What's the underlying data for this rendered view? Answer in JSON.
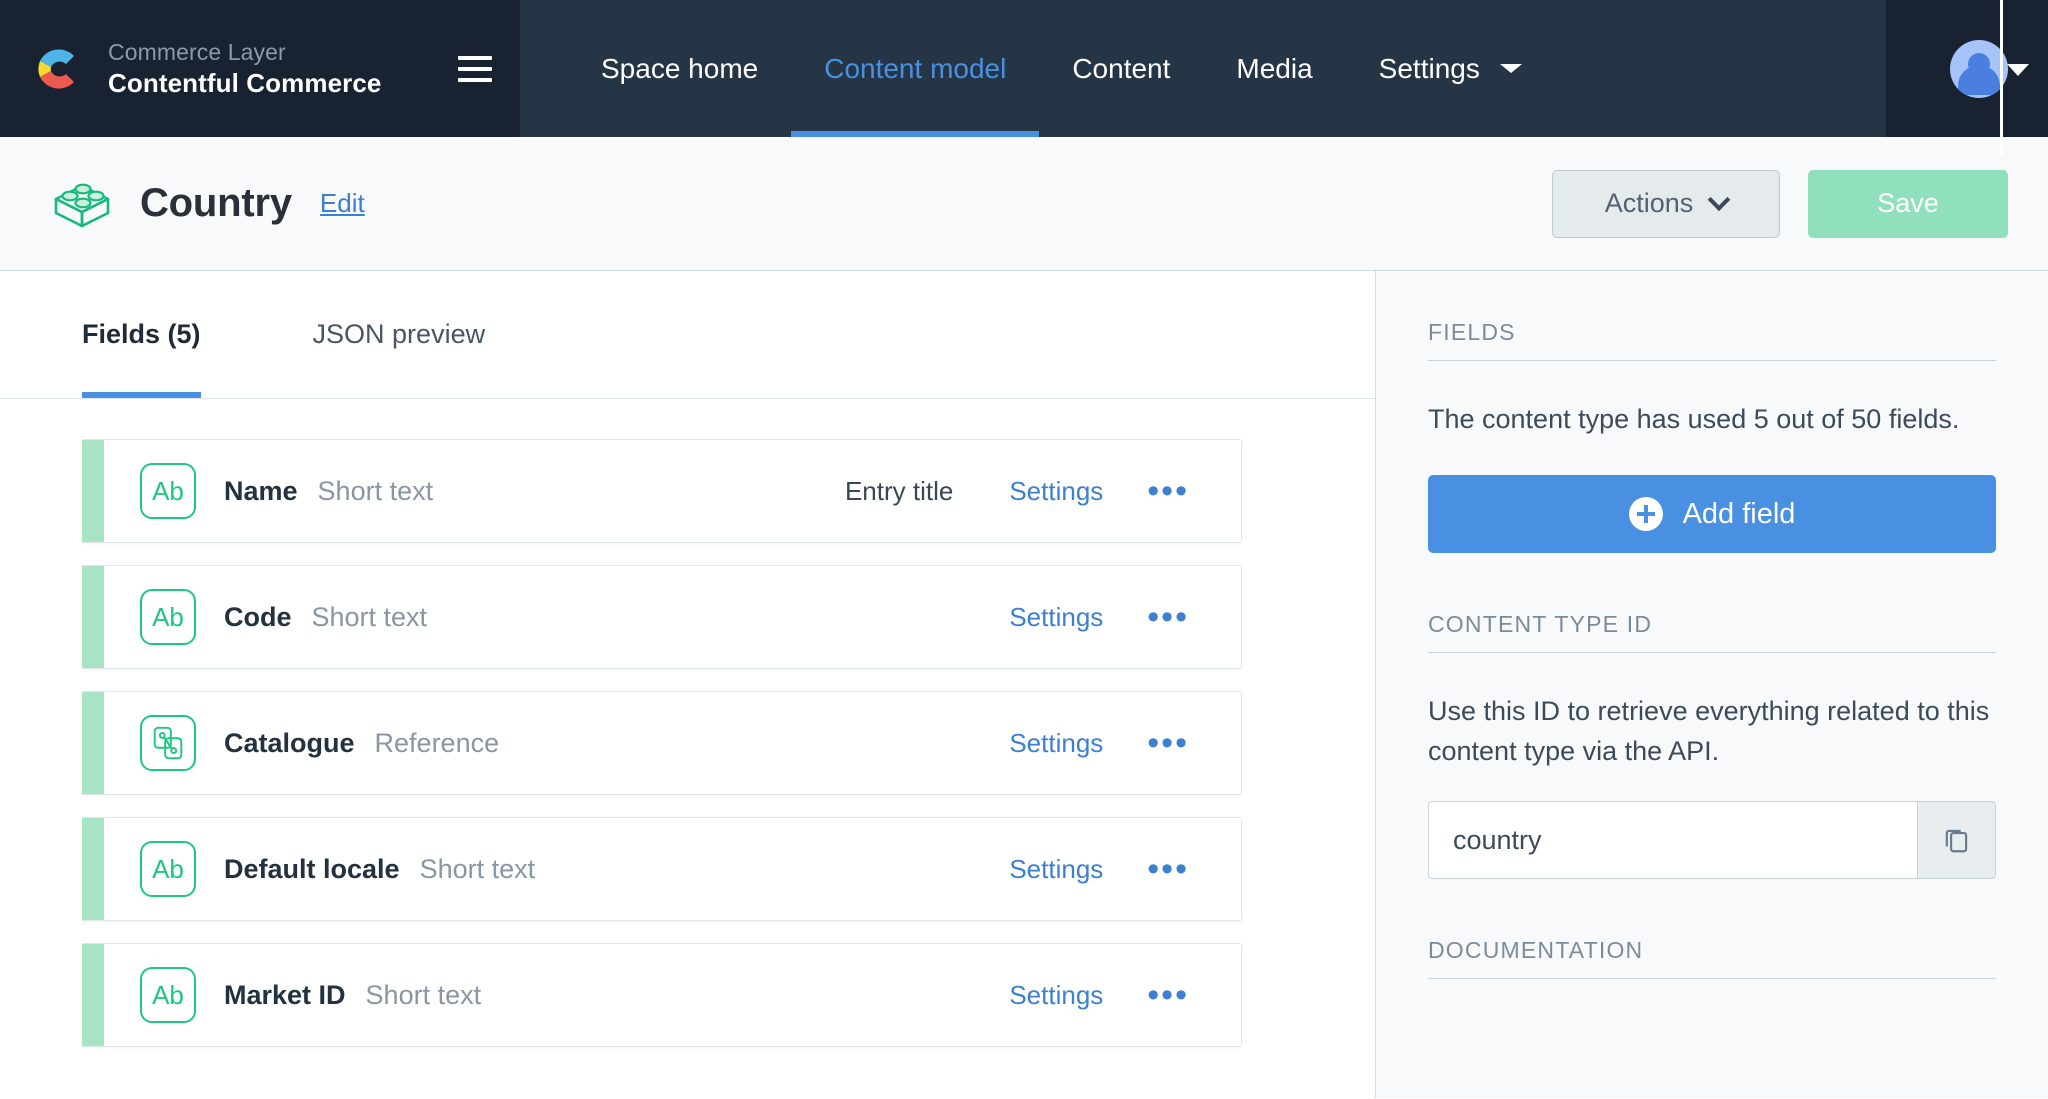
{
  "topnav": {
    "brand": {
      "org": "Commerce Layer",
      "space": "Contentful Commerce",
      "logo_icon": "commerce-layer-c-logo",
      "menu_icon": "hamburger-menu-icon"
    },
    "links": [
      {
        "label": "Space home",
        "active": false,
        "has_caret": false
      },
      {
        "label": "Content model",
        "active": true,
        "has_caret": false
      },
      {
        "label": "Content",
        "active": false,
        "has_caret": false
      },
      {
        "label": "Media",
        "active": false,
        "has_caret": false
      },
      {
        "label": "Settings",
        "active": false,
        "has_caret": true
      }
    ],
    "account": {
      "avatar_icon": "user-avatar-icon",
      "caret_icon": "chevron-down-icon"
    },
    "accent_color": "#4a90e2",
    "bar_color": "#253545",
    "brand_color": "#192231"
  },
  "pageheader": {
    "content_type_icon": "lego-brick-icon",
    "title": "Country",
    "edit_label": "Edit",
    "actions_label": "Actions",
    "actions_caret_icon": "chevron-down-icon",
    "save_label": "Save",
    "save_color": "#91e0bd"
  },
  "main": {
    "tabs": [
      {
        "label": "Fields (5)",
        "active": true
      },
      {
        "label": "JSON preview",
        "active": false
      }
    ],
    "fields": [
      {
        "name": "Name",
        "type": "Short text",
        "icon": "short-text-ab-icon",
        "icon_glyph": "Ab",
        "entry_title": "Entry title",
        "settings_label": "Settings",
        "more_label": "•••"
      },
      {
        "name": "Code",
        "type": "Short text",
        "icon": "short-text-ab-icon",
        "icon_glyph": "Ab",
        "entry_title": "",
        "settings_label": "Settings",
        "more_label": "•••"
      },
      {
        "name": "Catalogue",
        "type": "Reference",
        "icon": "reference-link-icon",
        "icon_glyph": "",
        "entry_title": "",
        "settings_label": "Settings",
        "more_label": "•••"
      },
      {
        "name": "Default locale",
        "type": "Short text",
        "icon": "short-text-ab-icon",
        "icon_glyph": "Ab",
        "entry_title": "",
        "settings_label": "Settings",
        "more_label": "•••"
      },
      {
        "name": "Market ID",
        "type": "Short text",
        "icon": "short-text-ab-icon",
        "icon_glyph": "Ab",
        "entry_title": "",
        "settings_label": "Settings",
        "more_label": "•••"
      }
    ]
  },
  "sidebar": {
    "fields_heading": "FIELDS",
    "fields_usage": "The content type has used 5 out of 50 fields.",
    "add_field_label": "Add field",
    "add_field_icon": "plus-circle-icon",
    "add_field_color": "#4a90e2",
    "id_heading": "CONTENT TYPE ID",
    "id_description": "Use this ID to retrieve everything related to this content type via the API.",
    "id_value": "country",
    "copy_icon": "copy-icon",
    "documentation_heading": "DOCUMENTATION"
  }
}
